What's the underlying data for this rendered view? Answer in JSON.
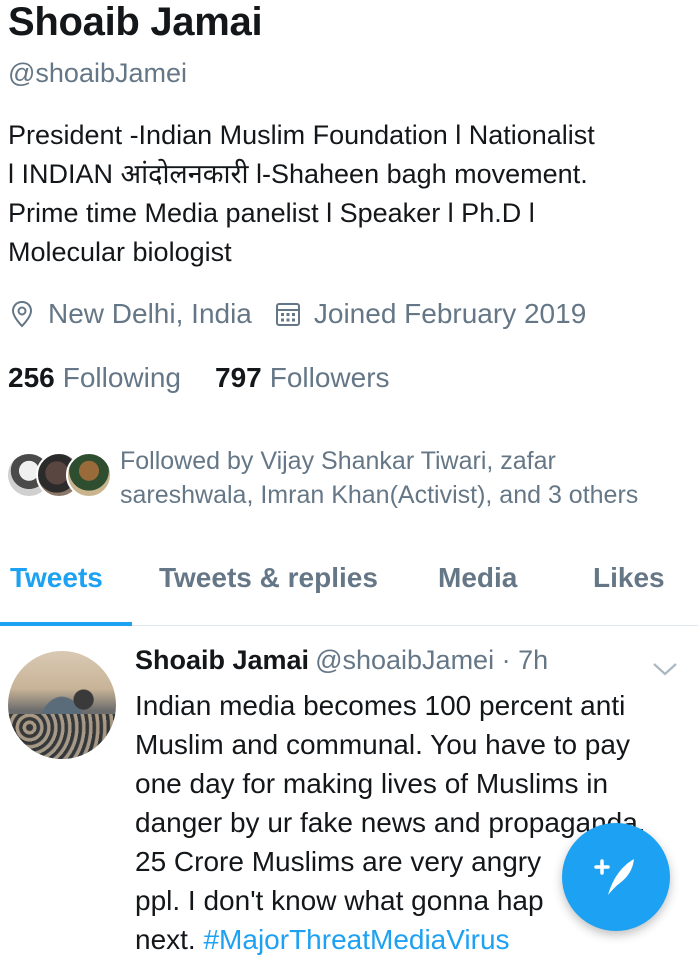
{
  "profile": {
    "name": "Shoaib Jamai",
    "handle": "@shoaibJamei",
    "bio_lines": [
      "President -Indian Muslim Foundation l Nationalist",
      "l INDIAN  आंदोलनकारी l-Shaheen bagh movement.",
      "Prime time Media panelist l Speaker l Ph.D l",
      "Molecular biologist"
    ],
    "location": "New Delhi, India",
    "joined": "Joined February 2019",
    "location_icon": "location-pin-icon",
    "calendar_icon": "calendar-icon"
  },
  "counts": {
    "following_num": "256",
    "following_label": "Following",
    "followers_num": "797",
    "followers_label": "Followers"
  },
  "followed_by": {
    "text_line1": "Followed by Vijay Shankar Tiwari, zafar",
    "text_line2": "sareshwala, Imran Khan(Activist), and 3 others"
  },
  "tabs": [
    {
      "label": "Tweets",
      "active": true
    },
    {
      "label": "Tweets & replies",
      "active": false
    },
    {
      "label": "Media",
      "active": false
    },
    {
      "label": "Likes",
      "active": false
    }
  ],
  "tweet": {
    "author_name": "Shoaib Jamai",
    "author_handle": "@shoaibJamei · 7h",
    "text_lines": [
      "Indian media becomes 100 percent anti",
      "Muslim and communal. You have to pay",
      "one day for making lives of Muslims in",
      "danger by ur fake news and propaganda.",
      "25 Crore Muslims are very angry",
      "ppl. I don't know what gonna hap",
      "next."
    ],
    "hashtag": "#MajorThreatMediaVirus"
  },
  "colors": {
    "accent": "#1da1f2",
    "secondary_text": "#657786",
    "primary_text": "#14171a"
  },
  "compose_icon": "compose-tweet-icon"
}
